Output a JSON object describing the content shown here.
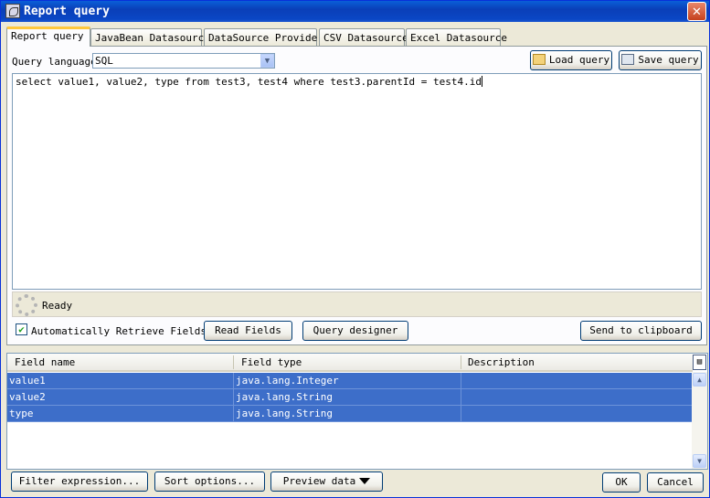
{
  "window": {
    "title": "Report query",
    "close_glyph": "✕"
  },
  "tabs": [
    {
      "label": "Report query",
      "active": true
    },
    {
      "label": "JavaBean Datasource"
    },
    {
      "label": "DataSource Provider"
    },
    {
      "label": "CSV Datasource"
    },
    {
      "label": "Excel Datasource"
    }
  ],
  "query": {
    "language_label": "Query language",
    "language_value": "SQL",
    "load_label": "Load query",
    "save_label": "Save query",
    "text": "select value1, value2, type from test3, test4 where test3.parentId = test4.id"
  },
  "status": {
    "text": "Ready"
  },
  "options": {
    "auto_retrieve_label": "Automatically Retrieve Fields",
    "auto_retrieve_checked": true,
    "read_fields_label": "Read Fields",
    "query_designer_label": "Query designer",
    "clipboard_label": "Send to clipboard"
  },
  "fields_table": {
    "columns": [
      "Field name",
      "Field type",
      "Description"
    ],
    "rows": [
      {
        "name": "value1",
        "type": "java.lang.Integer",
        "description": ""
      },
      {
        "name": "value2",
        "type": "java.lang.String",
        "description": ""
      },
      {
        "name": "type",
        "type": "java.lang.String",
        "description": ""
      }
    ],
    "selection_color": "#3d6ec9"
  },
  "footer": {
    "filter_label": "Filter expression...",
    "sort_label": "Sort options...",
    "preview_label": "Preview data",
    "ok_label": "OK",
    "cancel_label": "Cancel"
  },
  "icons": {
    "app": "report-app-icon",
    "load": "folder-icon",
    "save": "save-document-icon",
    "spinner": "loading-spinner-icon",
    "corner": "column-chooser-icon"
  }
}
